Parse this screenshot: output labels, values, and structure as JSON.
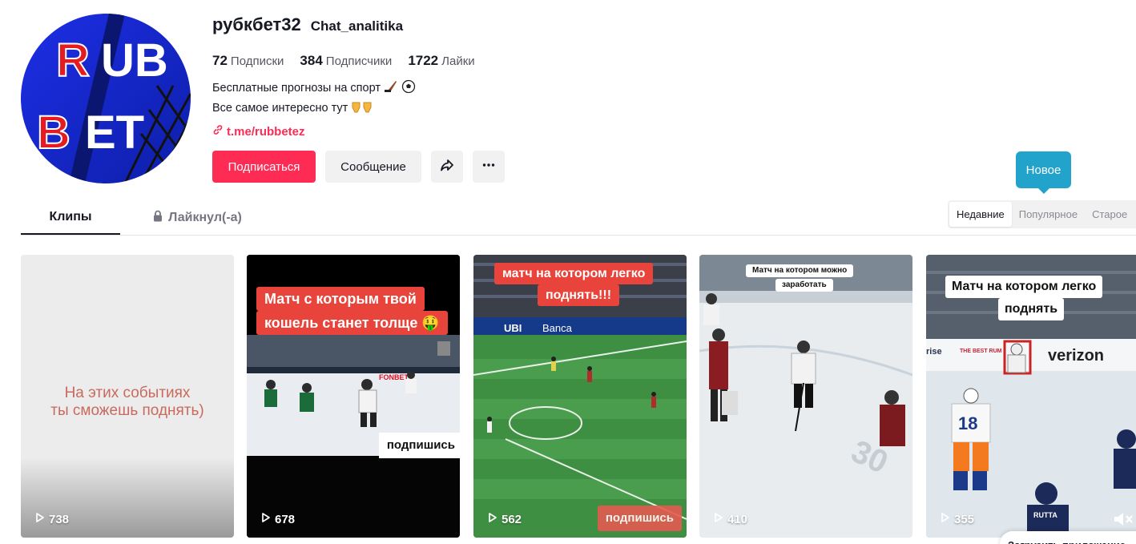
{
  "profile": {
    "username": "рубкбет32",
    "nickname": "Chat_analitika",
    "avatar_text": [
      "R",
      "UB",
      "B",
      "ET"
    ]
  },
  "stats": {
    "following_count": "72",
    "following_label": "Подписки",
    "followers_count": "384",
    "followers_label": "Подписчики",
    "likes_count": "1722",
    "likes_label": "Лайки"
  },
  "bio": {
    "line1": "Бесплатные прогнозы на спорт",
    "line2": "Все самое интересно тут"
  },
  "link": {
    "text": "t.me/rubbetez"
  },
  "actions": {
    "follow_label": "Подписаться",
    "message_label": "Сообщение",
    "share_icon": "share-icon",
    "more_icon": "more-dots-icon"
  },
  "tabs": {
    "clips_label": "Клипы",
    "liked_label": "Лайкнул(-а)"
  },
  "sort": {
    "tooltip": "Новое",
    "options": [
      "Недавние",
      "Популярное",
      "Старое"
    ],
    "selected": "Недавние"
  },
  "videos": [
    {
      "views": "738",
      "overlay_line1": "На этих событиях",
      "overlay_line2": "ты сможешь поднять)"
    },
    {
      "views": "678",
      "caption_line1": "Матч с которым твой",
      "caption_line2": "кошель станет толще 🤑",
      "badge": "подпишись",
      "ad": "FONBET"
    },
    {
      "views": "562",
      "caption_line1": "матч на котором легко",
      "caption_line2": "поднять!!!",
      "badge": "подпишись",
      "ad1": "UBI",
      "ad2": "Banca"
    },
    {
      "views": "410",
      "caption_line1": "Матч на котором можно",
      "caption_line2": "заработать",
      "rink_number": "30"
    },
    {
      "views": "355",
      "caption_line1": "Матч на котором легко",
      "caption_line2": "поднять",
      "ad": "verizon",
      "ad_small": "THE BEST RUM",
      "jersey": "18",
      "jersey2": "RUTTA"
    }
  ],
  "footer": {
    "app_banner": "Загрузить приложение"
  },
  "colors": {
    "brand": "#fe2c55",
    "tooltip": "#21a3cc",
    "text": "#161823"
  }
}
